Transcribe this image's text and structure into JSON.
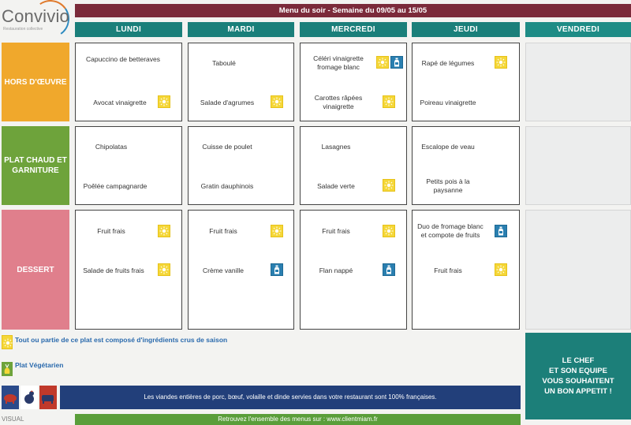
{
  "brand": {
    "name": "Convivio",
    "tagline": "Restauration collective"
  },
  "title": "Menu du soir - Semaine du 09/05 au 15/05",
  "days": [
    "LUNDI",
    "MARDI",
    "MERCREDI",
    "JEUDI",
    "VENDREDI"
  ],
  "categories": {
    "hors": "HORS D'ŒUVRE",
    "plat": "PLAT CHAUD ET GARNITURE",
    "dessert": "DESSERT"
  },
  "menu": {
    "lundi": {
      "hors_1": "Capuccino de betteraves",
      "hors_2": "Avocat vinaigrette",
      "plat_1": "Chipolatas",
      "plat_2": "Poêlée campagnarde",
      "dessert_1": "Fruit frais",
      "dessert_2": "Salade de fruits frais"
    },
    "mardi": {
      "hors_1": "Taboulé",
      "hors_2": "Salade d'agrumes",
      "plat_1": "Cuisse de poulet",
      "plat_2": "Gratin dauphinois",
      "dessert_1": "Fruit frais",
      "dessert_2": "Crème vanille"
    },
    "mercredi": {
      "hors_1": "Céléri vinaigrette fromage blanc",
      "hors_2": "Carottes râpées vinaigrette",
      "plat_1": "Lasagnes",
      "plat_2": "Salade verte",
      "dessert_1": "Fruit frais",
      "dessert_2": "Flan nappé"
    },
    "jeudi": {
      "hors_1": "Rapé de légumes",
      "hors_2": "Poireau vinaigrette",
      "plat_1": "Escalope de veau",
      "plat_2": "Petits pois à la paysanne",
      "dessert_1": "Duo de fromage blanc et compote de fruits",
      "dessert_2": "Fruit frais"
    }
  },
  "legend": {
    "seasonal": "Tout ou partie de ce plat est composé d'ingrédients crus de saison",
    "vegetarian": "Plat Végétarien"
  },
  "banner": "Les viandes entières de porc, bœuf, volaille et dinde servies dans votre restaurant sont 100% françaises.",
  "chef": {
    "line1": "LE CHEF",
    "line2": "ET SON EQUIPE",
    "line3": "VOUS SOUHAITENT",
    "line4": "UN BON APPETIT !"
  },
  "bottom": {
    "text": "Retrouvez l'ensemble des menus sur : www.clientmiam.fr",
    "left": "VISUAL"
  },
  "colors": {
    "title_bar": "#7b2a3a",
    "day_header": "#1a7f7a",
    "hors": "#f0a82c",
    "plat": "#6ea33b",
    "dessert": "#e07f8c",
    "banner": "#223f7a",
    "seasonal_badge": "#f5d738",
    "dairy_badge": "#2a7fb0"
  },
  "icons": [
    "sun-icon",
    "milk-bottle-icon",
    "vegetable-icon",
    "pig-icon",
    "chicken-icon",
    "cow-icon",
    "flag-fr-icon"
  ]
}
